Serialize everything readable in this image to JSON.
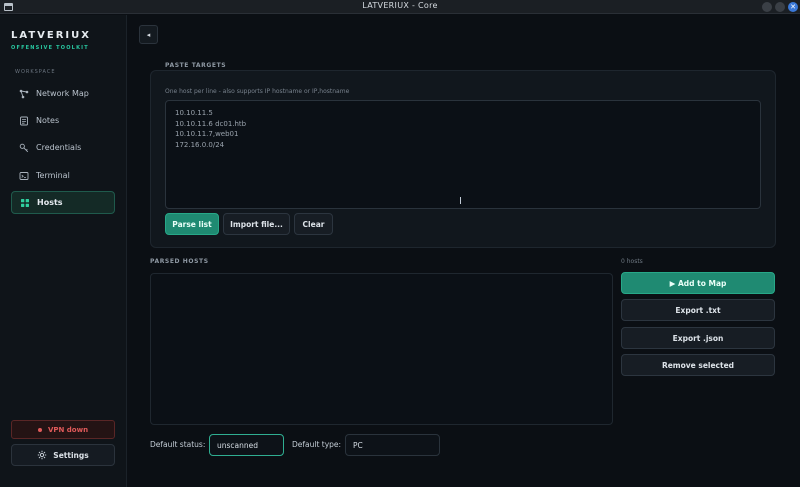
{
  "window": {
    "title": "LATVERIUX - Core"
  },
  "brand": {
    "name": "LATVERIUX",
    "subtitle": "OFFENSIVE TOOLKIT"
  },
  "sidebar": {
    "section": "WORKSPACE",
    "items": [
      {
        "label": "Network Map",
        "icon": "network-icon"
      },
      {
        "label": "Notes",
        "icon": "notes-icon"
      },
      {
        "label": "Credentials",
        "icon": "key-icon"
      },
      {
        "label": "Terminal",
        "icon": "terminal-icon"
      },
      {
        "label": "Hosts",
        "icon": "hosts-icon",
        "active": true
      }
    ],
    "vpn_status": "VPN down",
    "settings_label": "Settings"
  },
  "paste": {
    "heading": "PASTE TARGETS",
    "hint": "One host per line  -  also supports  IP hostname  or  IP,hostname",
    "targets": "10.10.11.5\n10.10.11.6 dc01.htb\n10.10.11.7,web01\n172.16.0.0/24",
    "parse_label": "Parse list",
    "import_label": "Import file...",
    "clear_label": "Clear"
  },
  "parsed": {
    "heading": "PARSED HOSTS",
    "count": "0 hosts",
    "add_label": "▶  Add to Map",
    "export_txt_label": "Export .txt",
    "export_json_label": "Export .json",
    "remove_label": "Remove selected"
  },
  "defaults": {
    "status_label": "Default status:",
    "status_value": "unscanned",
    "type_label": "Default type:",
    "type_value": "PC"
  },
  "colors": {
    "accent": "#1f8a72",
    "vpn_down": "#e05a5a",
    "background": "#0b0f14"
  }
}
